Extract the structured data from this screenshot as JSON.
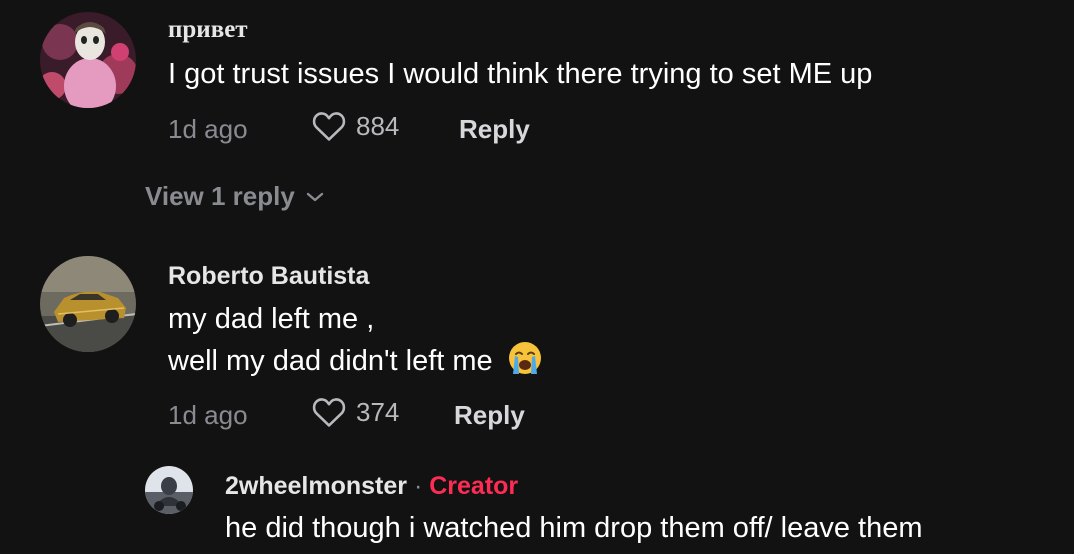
{
  "comments": [
    {
      "username": "привет",
      "text_lines": [
        "I got trust issues I would think there trying to set ME up"
      ],
      "time": "1d ago",
      "likes": "884",
      "reply_label": "Reply",
      "view_replies": "View 1 reply",
      "avatar_icon": "masked-figure-avatar"
    },
    {
      "username": "Roberto Bautista",
      "text_lines": [
        "my dad left me ,",
        "well my dad didn't left me"
      ],
      "emoji": "loudly-crying-face",
      "time": "1d ago",
      "likes": "374",
      "reply_label": "Reply",
      "avatar_icon": "gold-car-avatar"
    }
  ],
  "reply": {
    "username": "2wheelmonster",
    "separator": "·",
    "badge": "Creator",
    "badge_color": "#fe2c55",
    "text": "he did though i watched him drop them off/ leave them",
    "avatar_icon": "rider-avatar"
  },
  "colors": {
    "background": "#121212",
    "secondary_text": "#8a8b91",
    "primary_text": "#ffffff"
  }
}
